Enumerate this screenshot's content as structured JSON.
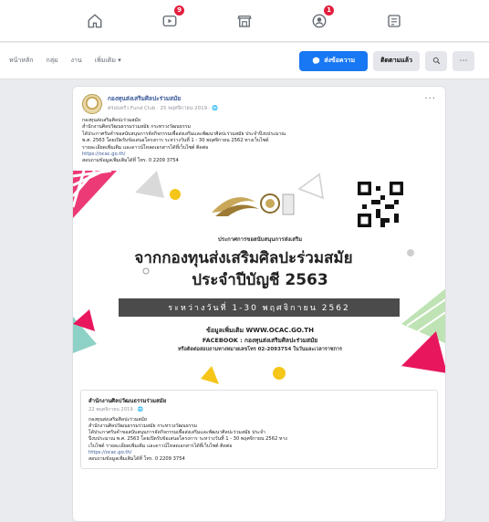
{
  "topnav": {
    "icons": [
      {
        "name": "home-icon",
        "badge": ""
      },
      {
        "name": "watch-icon",
        "badge": "9"
      },
      {
        "name": "marketplace-icon",
        "badge": ""
      },
      {
        "name": "groups-icon",
        "badge": "1"
      },
      {
        "name": "gaming-icon",
        "badge": ""
      }
    ]
  },
  "pagebar": {
    "tabs": [
      "หน้าหลัก",
      "กลุ่ม",
      "งาน",
      "เพิ่มเติม"
    ],
    "message_button": "ส่งข้อความ",
    "follow_button": "ติดตามแล้ว",
    "search_icon": "search-icon",
    "more_icon": "more-icon"
  },
  "post": {
    "author": "กองทุนส่งเสริมศิลปะร่วมสมัย",
    "meta": "ครอบครัว Fund Club · 25 พฤศจิกายน 2019 · 🌐",
    "lines": [
      "กองทุนส่งเสริมศิลปะร่วมสมัย",
      "สำนักงานศิลปวัฒนธรรมร่วมสมัย กระทรวงวัฒนธรรม",
      "ได้ประกาศรับคำขอสนับสนุนการจัดกิจกรรมเพื่อส่งเสริมและพัฒนาศิลปะร่วมสมัย ประจำปีงบประมาณ",
      "พ.ศ. 2563 โดยเปิดรับข้อเสนอโครงการ ระหว่างวันที่ 1 - 30 พฤศจิกายน 2562 ทางเว็บไซต์",
      "รายละเอียดเพิ่มเติม และดาวน์โหลดเอกสารได้ที่เว็บไซต์ ติดต่อ",
      "https://ocac.go.th/",
      "สอบถามข้อมูลเพิ่มเติมได้ที่ โทร. 0 2209 3754"
    ],
    "link_line_index": 5
  },
  "poster": {
    "caption1": "ประกาศการขอสนับสนุนการส่งเสริม",
    "caption2": "จากกองทุนส่งเสริมศิลปะร่วมสมัย",
    "caption3": "ประจำปีบัญชี 2563",
    "band": "ระหว่างวันที่ 1-30 พฤศจิกายน 2562",
    "info1": "ข้อมูลเพิ่มเติม WWW.OCAC.GO.TH",
    "info2": "FACEBOOK : กองทุนส่งเสริมศิลปะร่วมสมัย",
    "info3": "หรือติดต่อสอบถามทางหมายเลขโทร 02-2093754 ในวันและเวลาราชการ",
    "colors": {
      "pink": "#e8175d",
      "yellow": "#f5c518",
      "green": "#bfe3b4",
      "teal": "#8ed1c6",
      "gray": "#cfcfcf"
    }
  },
  "shared": {
    "author": "สำนักงานศิลปวัฒนธรรมร่วมสมัย",
    "meta": "22 พฤศจิกายน 2019 · 🌐",
    "lines": [
      "กองทุนส่งเสริมศิลปะร่วมสมัย",
      "สำนักงานศิลปวัฒนธรรมร่วมสมัย กระทรวงวัฒนธรรม",
      "ได้ประกาศรับคำขอสนับสนุนการจัดกิจกรรมเพื่อส่งเสริมและพัฒนาศิลปะร่วมสมัย ประจำ",
      "ปีงบประมาณ พ.ศ. 2563 โดยเปิดรับข้อเสนอโครงการ ระหว่างวันที่ 1 - 30 พฤศจิกายน 2562 ทาง",
      "เว็บไซต์ รายละเอียดเพิ่มเติม และดาวน์โหลดเอกสารได้ที่เว็บไซต์ ติดต่อ",
      "https://ocac.go.th/",
      "สอบถามข้อมูลเพิ่มเติมได้ที่ โทร. 0 2209 3754"
    ],
    "link_line_index": 5
  }
}
